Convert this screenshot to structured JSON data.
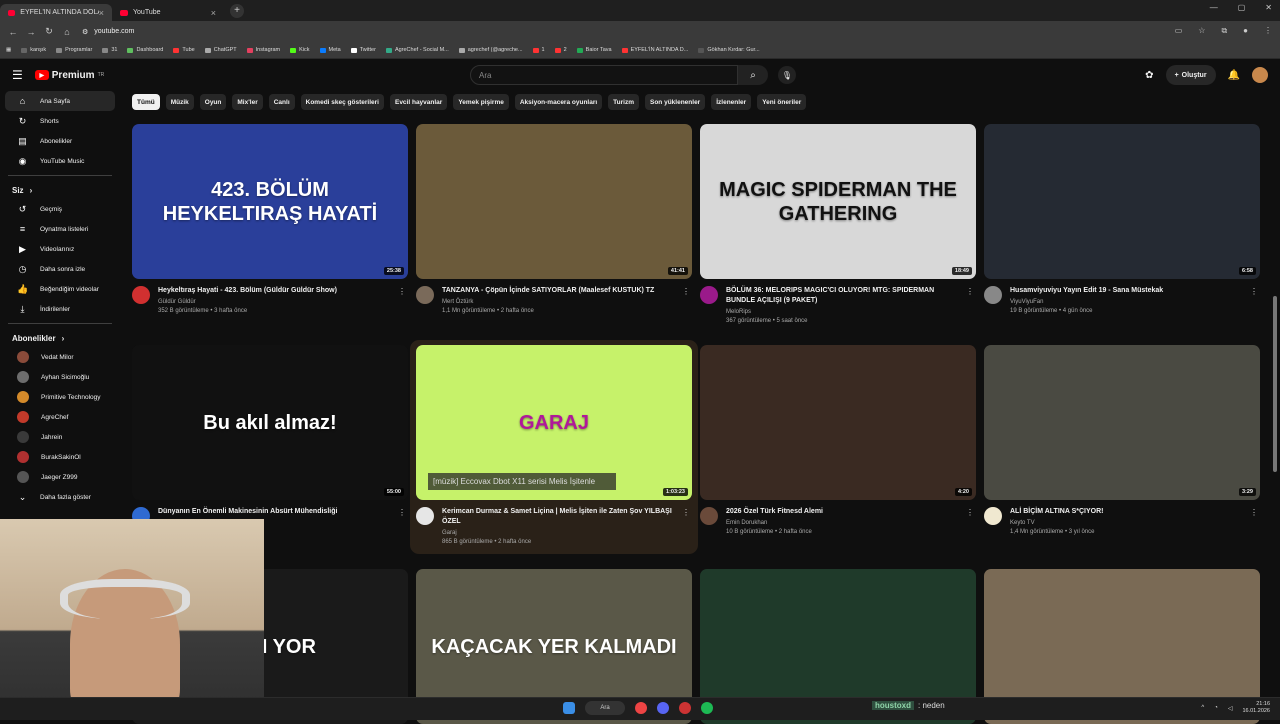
{
  "browser": {
    "tabs": [
      {
        "title": "EYFEL'İN ALTINDA DOLANDIRI"
      },
      {
        "title": "YouTube"
      }
    ],
    "url": "youtube.com",
    "bookmarks": [
      "kanşık",
      "Programlar",
      "31",
      "Dashboard",
      "Tube",
      "ChatGPT",
      "Instagram",
      "Kick",
      "Meta",
      "Twitter",
      "AgreChef - Social M...",
      "agrechef (@agreche...",
      "1",
      "2",
      "Baior Tava",
      "EYFEL'İN ALTINDA D...",
      "Gökhan Kırdar: Gur..."
    ]
  },
  "header": {
    "logo": "Premium",
    "logo_region": "TR",
    "search_placeholder": "Ara",
    "create_label": "Oluştur"
  },
  "sidebar": {
    "main": [
      {
        "label": "Ana Sayfa",
        "icon": "home-icon"
      },
      {
        "label": "Shorts",
        "icon": "shorts-icon"
      },
      {
        "label": "Abonelikler",
        "icon": "subscriptions-icon"
      },
      {
        "label": "YouTube Music",
        "icon": "music-icon"
      }
    ],
    "you_title": "Siz",
    "you": [
      {
        "label": "Geçmiş"
      },
      {
        "label": "Oynatma listeleri"
      },
      {
        "label": "Videolarınız"
      },
      {
        "label": "Daha sonra izle"
      },
      {
        "label": "Beğendiğim videolar"
      },
      {
        "label": "İndirilenler"
      }
    ],
    "subs_title": "Abonelikler",
    "subs": [
      {
        "label": "Vedat Milor",
        "color": "#8a4b3a"
      },
      {
        "label": "Ayhan Sicimoğlu",
        "color": "#6d6d6d"
      },
      {
        "label": "Primitive Technology",
        "color": "#d48a2a"
      },
      {
        "label": "AgreChef",
        "color": "#c23a2a"
      },
      {
        "label": "Jahrein",
        "color": "#3a3a3a"
      },
      {
        "label": "BurakSakinOl",
        "color": "#b03030"
      },
      {
        "label": "Jaeger Z999",
        "color": "#555"
      }
    ],
    "more": "Daha fazla göster"
  },
  "chips": [
    "Tümü",
    "Müzik",
    "Oyun",
    "Mix'ler",
    "Canlı",
    "Komedi skeç gösterileri",
    "Evcil hayvanlar",
    "Yemek pişirme",
    "Aksiyon-macera oyunları",
    "Turizm",
    "Son yüklenenler",
    "İzlenenler",
    "Yeni öneriler"
  ],
  "videos": [
    {
      "title": "Heykeltıraş Hayati - 423. Bölüm (Güldür Güldür Show)",
      "channel": "Güldür Güldür",
      "stats": "352 B görüntüleme • 3 hafta önce",
      "duration": "25:38",
      "thumb_text": "423. BÖLÜM HEYKELTIRAŞ HAYATİ",
      "color": "#2a3f9a",
      "chav": "#d13030"
    },
    {
      "title": "TANZANYA - Çöpün İçinde SATIYORLAR (Maalesef KUSTUK) TZ",
      "channel": "Mert Öztürk",
      "stats": "1,1 Mn görüntüleme • 2 hafta önce",
      "duration": "41:41",
      "thumb_text": "",
      "color": "#6b5a3a",
      "chav": "#7a6a5a"
    },
    {
      "title": "BÖLÜM 36: MELORIPS MAGIC'CI OLUYOR! MTG: SPIDERMAN BUNDLE AÇILIŞI (9 PAKET)",
      "channel": "MeloRips",
      "stats": "367 görüntüleme • 5 saat önce",
      "duration": "18:49",
      "thumb_text": "MAGIC SPIDERMAN THE GATHERING",
      "color": "#d8d8d8",
      "chav": "#9a1a8a"
    },
    {
      "title": "Husamviyuviyu Yayın Edit 19 - Sana Müstekak",
      "channel": "ViyuViyuFan",
      "stats": "19 B görüntüleme • 4 gün önce",
      "duration": "6:58",
      "thumb_text": "",
      "color": "#252a33",
      "chav": "#888"
    },
    {
      "title": "Dünyanın En Önemli Makinesinin Absürt Mühendisliği",
      "channel": "",
      "stats": "",
      "duration": "55:00",
      "thumb_text": "Bu akıl almaz!",
      "color": "#111",
      "chav": "#2f6ad1"
    },
    {
      "title": "Kerimcan Durmaz & Samet Liçina | Melis İşiten ile Zaten Şov YILBAŞI ÖZEL",
      "channel": "Garaj",
      "stats": "865 B görüntüleme • 2 hafta önce",
      "duration": "1:03:23",
      "thumb_text": "GARAJ",
      "caption": "[müzik] Eccovax Dbot X11 serisi Melis İşitenle",
      "color": "#c6f26a",
      "chav": "#e6e6e6"
    },
    {
      "title": "2026 Özel Türk Fitnesd Alemi",
      "channel": "Emin Dorukhan",
      "stats": "10 B görüntüleme • 2 hafta önce",
      "duration": "4:20",
      "thumb_text": "",
      "color": "#3a2a22",
      "chav": "#6a4a3a"
    },
    {
      "title": "ALİ BİÇİM ALTINA S*ÇIYOR!",
      "channel": "Keyto TV",
      "stats": "1,4 Mn görüntüleme • 3 yıl önce",
      "duration": "3:29",
      "thumb_text": "",
      "color": "#4a4a42",
      "chav": "#f0e8d0"
    },
    {
      "title": "",
      "channel": "",
      "stats": "",
      "duration": "",
      "thumb_text": "ZAM YOR",
      "color": "#1a1a1a",
      "chav": "#333"
    },
    {
      "title": "",
      "channel": "",
      "stats": "",
      "duration": "",
      "thumb_text": "KAÇACAK YER KALMADI",
      "color": "#5a5848",
      "chav": "#333"
    },
    {
      "title": "",
      "channel": "",
      "stats": "",
      "duration": "",
      "thumb_text": "",
      "color": "#1f3a2a",
      "chav": "#333"
    },
    {
      "title": "",
      "channel": "",
      "stats": "",
      "duration": "",
      "thumb_text": "",
      "color": "#7a6a55",
      "chav": "#333"
    }
  ],
  "taskbar": {
    "search": "Ara",
    "chat_user": "houstoxd",
    "chat_text": ": neden",
    "time": "21:16",
    "date": "16.01.2026"
  }
}
